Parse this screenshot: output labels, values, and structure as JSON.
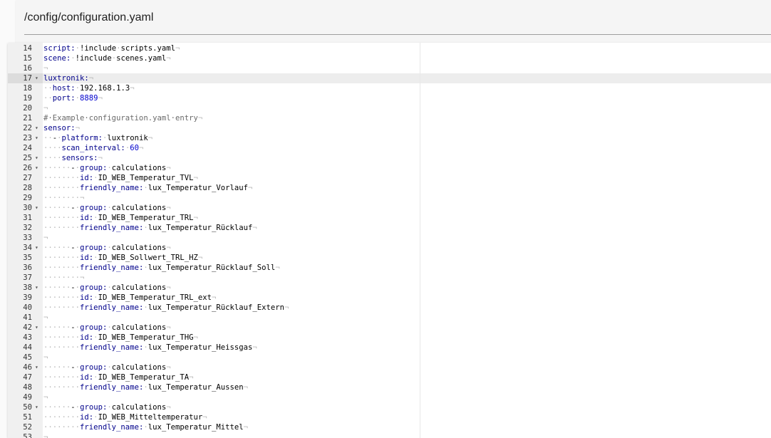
{
  "file": {
    "path": "/config/configuration.yaml"
  },
  "editor": {
    "active_line": 17,
    "lines": [
      {
        "n": "14",
        "fold": false,
        "parts": [
          [
            "key",
            "script:"
          ],
          [
            "ws",
            "·"
          ],
          [
            "txt",
            "!include"
          ],
          [
            "ws",
            "·"
          ],
          [
            "txt",
            "scripts.yaml"
          ],
          [
            "ws",
            "¬"
          ]
        ]
      },
      {
        "n": "15",
        "fold": false,
        "parts": [
          [
            "key",
            "scene:"
          ],
          [
            "ws",
            "·"
          ],
          [
            "txt",
            "!include"
          ],
          [
            "ws",
            "·"
          ],
          [
            "txt",
            "scenes.yaml"
          ],
          [
            "ws",
            "¬"
          ]
        ]
      },
      {
        "n": "16",
        "fold": false,
        "parts": [
          [
            "ws",
            "¬"
          ]
        ]
      },
      {
        "n": "17",
        "fold": true,
        "parts": [
          [
            "key",
            "luxtronik:"
          ],
          [
            "ws",
            "¬"
          ]
        ]
      },
      {
        "n": "18",
        "fold": false,
        "parts": [
          [
            "ws",
            "··"
          ],
          [
            "key",
            "host:"
          ],
          [
            "ws",
            "·"
          ],
          [
            "txt",
            "192.168.1.3"
          ],
          [
            "ws",
            "¬"
          ]
        ]
      },
      {
        "n": "19",
        "fold": false,
        "parts": [
          [
            "ws",
            "··"
          ],
          [
            "key",
            "port:"
          ],
          [
            "ws",
            "·"
          ],
          [
            "num",
            "8889"
          ],
          [
            "ws",
            "¬"
          ]
        ]
      },
      {
        "n": "20",
        "fold": false,
        "parts": [
          [
            "ws",
            "¬"
          ]
        ]
      },
      {
        "n": "21",
        "fold": false,
        "parts": [
          [
            "cmt",
            "#·Example·configuration.yaml·entry"
          ],
          [
            "ws",
            "¬"
          ]
        ]
      },
      {
        "n": "22",
        "fold": true,
        "parts": [
          [
            "key",
            "sensor:"
          ],
          [
            "ws",
            "¬"
          ]
        ]
      },
      {
        "n": "23",
        "fold": true,
        "parts": [
          [
            "ws",
            "··"
          ],
          [
            "txt",
            "-"
          ],
          [
            "ws",
            "·"
          ],
          [
            "key",
            "platform:"
          ],
          [
            "ws",
            "·"
          ],
          [
            "txt",
            "luxtronik"
          ],
          [
            "ws",
            "¬"
          ]
        ]
      },
      {
        "n": "24",
        "fold": false,
        "parts": [
          [
            "ws",
            "····"
          ],
          [
            "key",
            "scan_interval:"
          ],
          [
            "ws",
            "·"
          ],
          [
            "num",
            "60"
          ],
          [
            "ws",
            "¬"
          ]
        ]
      },
      {
        "n": "25",
        "fold": true,
        "parts": [
          [
            "ws",
            "····"
          ],
          [
            "key",
            "sensors:"
          ],
          [
            "ws",
            "¬"
          ]
        ]
      },
      {
        "n": "26",
        "fold": true,
        "parts": [
          [
            "ws",
            "······"
          ],
          [
            "txt",
            "-"
          ],
          [
            "ws",
            "·"
          ],
          [
            "key",
            "group:"
          ],
          [
            "ws",
            "·"
          ],
          [
            "txt",
            "calculations"
          ],
          [
            "ws",
            "¬"
          ]
        ]
      },
      {
        "n": "27",
        "fold": false,
        "parts": [
          [
            "ws",
            "········"
          ],
          [
            "key",
            "id:"
          ],
          [
            "ws",
            "·"
          ],
          [
            "txt",
            "ID_WEB_Temperatur_TVL"
          ],
          [
            "ws",
            "¬"
          ]
        ]
      },
      {
        "n": "28",
        "fold": false,
        "parts": [
          [
            "ws",
            "········"
          ],
          [
            "key",
            "friendly_name:"
          ],
          [
            "ws",
            "·"
          ],
          [
            "txt",
            "lux_Temperatur_Vorlauf"
          ],
          [
            "ws",
            "¬"
          ]
        ]
      },
      {
        "n": "29",
        "fold": false,
        "parts": [
          [
            "ws",
            "········¬"
          ]
        ]
      },
      {
        "n": "30",
        "fold": true,
        "parts": [
          [
            "ws",
            "······"
          ],
          [
            "txt",
            "-"
          ],
          [
            "ws",
            "·"
          ],
          [
            "key",
            "group:"
          ],
          [
            "ws",
            "·"
          ],
          [
            "txt",
            "calculations"
          ],
          [
            "ws",
            "¬"
          ]
        ]
      },
      {
        "n": "31",
        "fold": false,
        "parts": [
          [
            "ws",
            "········"
          ],
          [
            "key",
            "id:"
          ],
          [
            "ws",
            "·"
          ],
          [
            "txt",
            "ID_WEB_Temperatur_TRL"
          ],
          [
            "ws",
            "¬"
          ]
        ]
      },
      {
        "n": "32",
        "fold": false,
        "parts": [
          [
            "ws",
            "········"
          ],
          [
            "key",
            "friendly_name:"
          ],
          [
            "ws",
            "·"
          ],
          [
            "txt",
            "lux_Temperatur_Rücklauf"
          ],
          [
            "ws",
            "¬"
          ]
        ]
      },
      {
        "n": "33",
        "fold": false,
        "parts": [
          [
            "ws",
            "¬"
          ]
        ]
      },
      {
        "n": "34",
        "fold": true,
        "parts": [
          [
            "ws",
            "······"
          ],
          [
            "txt",
            "-"
          ],
          [
            "ws",
            "·"
          ],
          [
            "key",
            "group:"
          ],
          [
            "ws",
            "·"
          ],
          [
            "txt",
            "calculations"
          ],
          [
            "ws",
            "¬"
          ]
        ]
      },
      {
        "n": "35",
        "fold": false,
        "parts": [
          [
            "ws",
            "········"
          ],
          [
            "key",
            "id:"
          ],
          [
            "ws",
            "·"
          ],
          [
            "txt",
            "ID_WEB_Sollwert_TRL_HZ"
          ],
          [
            "ws",
            "¬"
          ]
        ]
      },
      {
        "n": "36",
        "fold": false,
        "parts": [
          [
            "ws",
            "········"
          ],
          [
            "key",
            "friendly_name:"
          ],
          [
            "ws",
            "·"
          ],
          [
            "txt",
            "lux_Temperatur_Rücklauf_Soll"
          ],
          [
            "ws",
            "¬"
          ]
        ]
      },
      {
        "n": "37",
        "fold": false,
        "parts": [
          [
            "ws",
            "········¬"
          ]
        ]
      },
      {
        "n": "38",
        "fold": true,
        "parts": [
          [
            "ws",
            "······"
          ],
          [
            "txt",
            "-"
          ],
          [
            "ws",
            "·"
          ],
          [
            "key",
            "group:"
          ],
          [
            "ws",
            "·"
          ],
          [
            "txt",
            "calculations"
          ],
          [
            "ws",
            "¬"
          ]
        ]
      },
      {
        "n": "39",
        "fold": false,
        "parts": [
          [
            "ws",
            "········"
          ],
          [
            "key",
            "id:"
          ],
          [
            "ws",
            "·"
          ],
          [
            "txt",
            "ID_WEB_Temperatur_TRL_ext"
          ],
          [
            "ws",
            "¬"
          ]
        ]
      },
      {
        "n": "40",
        "fold": false,
        "parts": [
          [
            "ws",
            "········"
          ],
          [
            "key",
            "friendly_name:"
          ],
          [
            "ws",
            "·"
          ],
          [
            "txt",
            "lux_Temperatur_Rücklauf_Extern"
          ],
          [
            "ws",
            "¬"
          ]
        ]
      },
      {
        "n": "41",
        "fold": false,
        "parts": [
          [
            "ws",
            "¬"
          ]
        ]
      },
      {
        "n": "42",
        "fold": true,
        "parts": [
          [
            "ws",
            "······"
          ],
          [
            "txt",
            "-"
          ],
          [
            "ws",
            "·"
          ],
          [
            "key",
            "group:"
          ],
          [
            "ws",
            "·"
          ],
          [
            "txt",
            "calculations"
          ],
          [
            "ws",
            "¬"
          ]
        ]
      },
      {
        "n": "43",
        "fold": false,
        "parts": [
          [
            "ws",
            "········"
          ],
          [
            "key",
            "id:"
          ],
          [
            "ws",
            "·"
          ],
          [
            "txt",
            "ID_WEB_Temperatur_THG"
          ],
          [
            "ws",
            "¬"
          ]
        ]
      },
      {
        "n": "44",
        "fold": false,
        "parts": [
          [
            "ws",
            "········"
          ],
          [
            "key",
            "friendly_name:"
          ],
          [
            "ws",
            "·"
          ],
          [
            "txt",
            "lux_Temperatur_Heissgas"
          ],
          [
            "ws",
            "¬"
          ]
        ]
      },
      {
        "n": "45",
        "fold": false,
        "parts": [
          [
            "ws",
            "¬"
          ]
        ]
      },
      {
        "n": "46",
        "fold": true,
        "parts": [
          [
            "ws",
            "······"
          ],
          [
            "txt",
            "-"
          ],
          [
            "ws",
            "·"
          ],
          [
            "key",
            "group:"
          ],
          [
            "ws",
            "·"
          ],
          [
            "txt",
            "calculations"
          ],
          [
            "ws",
            "¬"
          ]
        ]
      },
      {
        "n": "47",
        "fold": false,
        "parts": [
          [
            "ws",
            "········"
          ],
          [
            "key",
            "id:"
          ],
          [
            "ws",
            "·"
          ],
          [
            "txt",
            "ID_WEB_Temperatur_TA"
          ],
          [
            "ws",
            "¬"
          ]
        ]
      },
      {
        "n": "48",
        "fold": false,
        "parts": [
          [
            "ws",
            "········"
          ],
          [
            "key",
            "friendly_name:"
          ],
          [
            "ws",
            "·"
          ],
          [
            "txt",
            "lux_Temperatur_Aussen"
          ],
          [
            "ws",
            "¬"
          ]
        ]
      },
      {
        "n": "49",
        "fold": false,
        "parts": [
          [
            "ws",
            "¬"
          ]
        ]
      },
      {
        "n": "50",
        "fold": true,
        "parts": [
          [
            "ws",
            "······"
          ],
          [
            "txt",
            "-"
          ],
          [
            "ws",
            "·"
          ],
          [
            "key",
            "group:"
          ],
          [
            "ws",
            "·"
          ],
          [
            "txt",
            "calculations"
          ],
          [
            "ws",
            "¬"
          ]
        ]
      },
      {
        "n": "51",
        "fold": false,
        "parts": [
          [
            "ws",
            "········"
          ],
          [
            "key",
            "id:"
          ],
          [
            "ws",
            "·"
          ],
          [
            "txt",
            "ID_WEB_Mitteltemperatur"
          ],
          [
            "ws",
            "¬"
          ]
        ]
      },
      {
        "n": "52",
        "fold": false,
        "parts": [
          [
            "ws",
            "········"
          ],
          [
            "key",
            "friendly_name:"
          ],
          [
            "ws",
            "·"
          ],
          [
            "txt",
            "lux_Temperatur_Mittel"
          ],
          [
            "ws",
            "¬"
          ]
        ]
      },
      {
        "n": "53",
        "fold": false,
        "parts": [
          [
            "ws",
            "¬"
          ]
        ]
      }
    ]
  }
}
